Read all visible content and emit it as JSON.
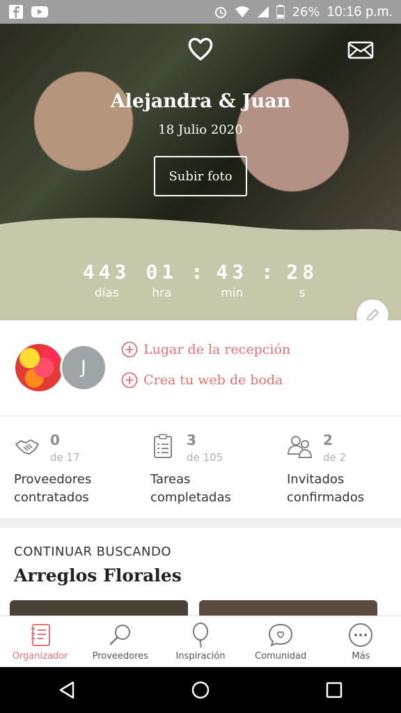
{
  "status_bar": {
    "battery": "26%",
    "time": "10:16 p.m.",
    "left_icons": [
      "facebook-icon",
      "youtube-icon"
    ],
    "right_icons": [
      "alarm-icon",
      "wifi-icon",
      "signal-icon",
      "battery-icon"
    ]
  },
  "hero": {
    "couple_names": "Alejandra & Juan",
    "wedding_date": "18 Julio 2020",
    "upload_button": "Subir foto"
  },
  "countdown": {
    "days": "443",
    "hours": "01",
    "minutes": "43",
    "seconds": "28",
    "days_label": "días",
    "hours_label": "hra",
    "minutes_label": "min",
    "seconds_label": "s",
    "separator": ":"
  },
  "profile": {
    "avatar_initial": "J",
    "links": [
      "Lugar de la recepción",
      "Crea tu web de boda"
    ]
  },
  "stats": [
    {
      "count": "0",
      "of": "de 17",
      "label": "Proveedores\ncontratados",
      "icon": "handshake-icon"
    },
    {
      "count": "3",
      "of": "de 105",
      "label": "Tareas\ncompletadas",
      "icon": "checklist-icon"
    },
    {
      "count": "2",
      "of": "de 2",
      "label": "Invitados\nconfirmados",
      "icon": "guests-icon"
    }
  ],
  "continue": {
    "kicker": "CONTINUAR BUSCANDO",
    "title": "Arreglos Florales"
  },
  "tabbar": {
    "tabs": [
      {
        "label": "Organizador",
        "active": true
      },
      {
        "label": "Proveedores",
        "active": false
      },
      {
        "label": "Inspiración",
        "active": false
      },
      {
        "label": "Comunidad",
        "active": false
      },
      {
        "label": "Más",
        "active": false
      }
    ]
  },
  "colors": {
    "accent": "#e57373",
    "countdown_bg": "#c7c8aa",
    "status_bar": "#9e9e9e"
  }
}
